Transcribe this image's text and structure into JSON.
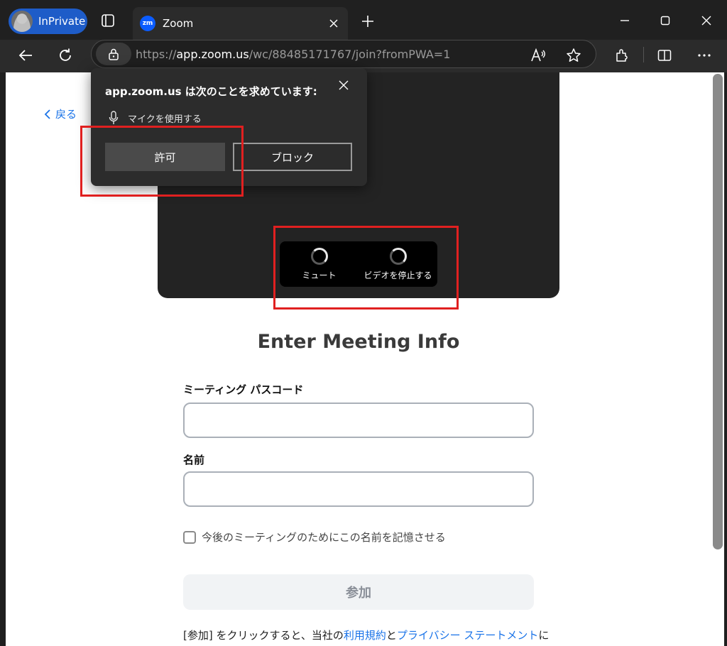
{
  "browser": {
    "profile_label": "InPrivate",
    "tab_title": "Zoom",
    "tab_favicon": "zm",
    "url_scheme": "https://",
    "url_host": "app.zoom.us",
    "url_path": "/wc/88485171767/join?fromPWA=1"
  },
  "popup": {
    "title": "app.zoom.us は次のことを求めています:",
    "permission": "マイクを使用する",
    "allow_label": "許可",
    "block_label": "ブロック"
  },
  "page": {
    "back_label": "戻る",
    "mute_label": "ミュート",
    "stop_video_label": "ビデオを停止する",
    "heading": "Enter Meeting Info",
    "passcode_label": "ミーティング パスコード",
    "passcode_value": "",
    "name_label": "名前",
    "name_value": "",
    "remember_label": "今後のミーティングのためにこの名前を記憶させる",
    "join_label": "参加",
    "terms_prefix": "[参加] をクリックすると、当社の",
    "terms_link": "利用規約",
    "terms_and": "と",
    "privacy_link": "プライバシー ステートメント",
    "terms_suffix": "に"
  },
  "colors": {
    "accent": "#0b5cff",
    "link": "#1a73e8",
    "highlight": "#e02020"
  }
}
